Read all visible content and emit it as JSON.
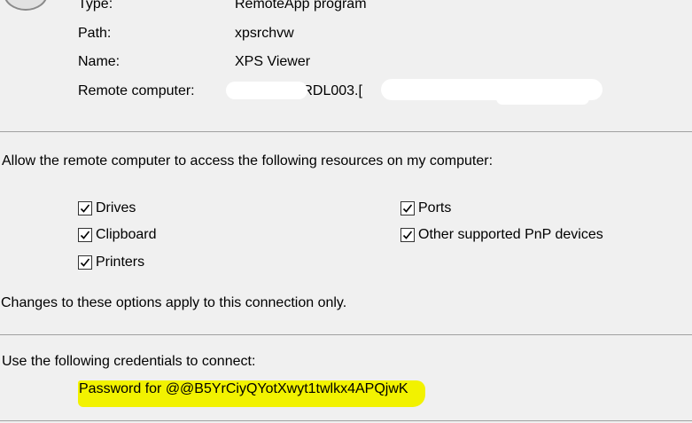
{
  "details": {
    "type_label": "Type:",
    "type_value": "RemoteApp program",
    "path_label": "Path:",
    "path_value": "xpsrchvw",
    "name_label": "Name:",
    "name_value": "XPS Viewer",
    "remote_label": "Remote computer:",
    "remote_value_visible": "-RDL003.[",
    "remote_tail_visible": "......................·.··"
  },
  "resources": {
    "heading": "Allow the remote computer to access the following resources on my computer:",
    "options": [
      {
        "label": "Drives",
        "checked": true
      },
      {
        "label": "Clipboard",
        "checked": true
      },
      {
        "label": "Printers",
        "checked": true
      },
      {
        "label": "Ports",
        "checked": true
      },
      {
        "label": "Other supported PnP devices",
        "checked": true
      }
    ],
    "note": "Changes to these options apply to this connection only."
  },
  "credentials": {
    "heading": "Use the following credentials to connect:",
    "value": "Password for @@B5YrCiyQYotXwyt1twlkx4APQjwK",
    "highlight_color": "#f2f200"
  },
  "icons": {
    "app": "remoteapp-icon",
    "check": "checkmark-icon"
  }
}
